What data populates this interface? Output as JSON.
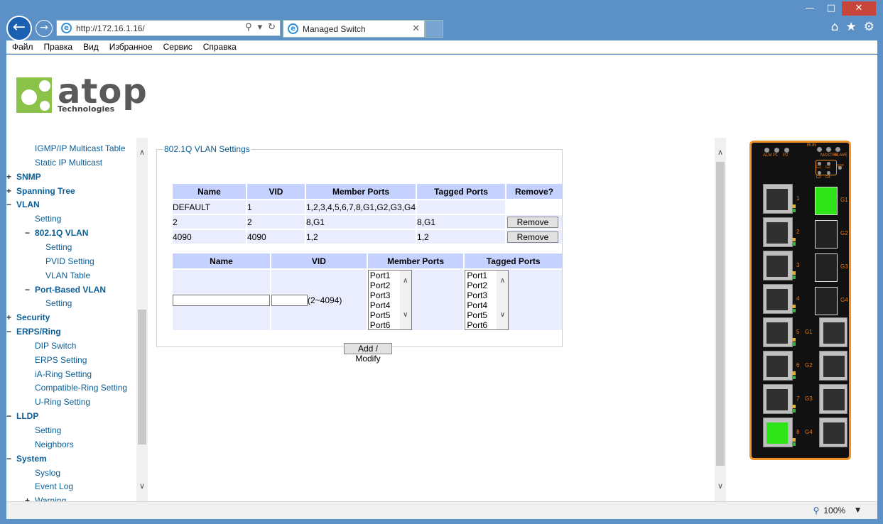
{
  "browser": {
    "url": "http://172.16.1.16/",
    "tab_title": "Managed Switch",
    "menu": [
      "Файл",
      "Правка",
      "Вид",
      "Избранное",
      "Сервис",
      "Справка"
    ],
    "zoom": "100%"
  },
  "logo": {
    "brand": "atop",
    "sub": "Technologies"
  },
  "sidebar": {
    "items": [
      {
        "label": "IGMP/IP Multicast Table",
        "toggle": "",
        "level": 1
      },
      {
        "label": "Static IP Multicast",
        "toggle": "",
        "level": 1
      },
      {
        "label": "SNMP",
        "toggle": "+",
        "level": 0
      },
      {
        "label": "Spanning Tree",
        "toggle": "+",
        "level": 0
      },
      {
        "label": "VLAN",
        "toggle": "−",
        "level": 0
      },
      {
        "label": "Setting",
        "toggle": "",
        "level": 1
      },
      {
        "label": "802.1Q VLAN",
        "toggle": "−",
        "level": 1,
        "bold": true
      },
      {
        "label": "Setting",
        "toggle": "",
        "level": 2
      },
      {
        "label": "PVID Setting",
        "toggle": "",
        "level": 2
      },
      {
        "label": "VLAN Table",
        "toggle": "",
        "level": 2
      },
      {
        "label": "Port-Based VLAN",
        "toggle": "−",
        "level": 1,
        "bold": true
      },
      {
        "label": "Setting",
        "toggle": "",
        "level": 2
      },
      {
        "label": "Security",
        "toggle": "+",
        "level": 0
      },
      {
        "label": "ERPS/Ring",
        "toggle": "−",
        "level": 0
      },
      {
        "label": "DIP Switch",
        "toggle": "",
        "level": 1
      },
      {
        "label": "ERPS Setting",
        "toggle": "",
        "level": 1
      },
      {
        "label": "iA-Ring Setting",
        "toggle": "",
        "level": 1
      },
      {
        "label": "Compatible-Ring Setting",
        "toggle": "",
        "level": 1
      },
      {
        "label": "U-Ring Setting",
        "toggle": "",
        "level": 1
      },
      {
        "label": "LLDP",
        "toggle": "−",
        "level": 0
      },
      {
        "label": "Setting",
        "toggle": "",
        "level": 1
      },
      {
        "label": "Neighbors",
        "toggle": "",
        "level": 1
      },
      {
        "label": "System",
        "toggle": "−",
        "level": 0
      },
      {
        "label": "Syslog",
        "toggle": "",
        "level": 1
      },
      {
        "label": "Event Log",
        "toggle": "",
        "level": 1
      },
      {
        "label": "Warning",
        "toggle": "+",
        "level": 1
      }
    ]
  },
  "vlan_settings": {
    "legend": "802.1Q VLAN Settings",
    "list_headers": [
      "Name",
      "VID",
      "Member Ports",
      "Tagged Ports",
      "Remove?"
    ],
    "rows": [
      {
        "name": "DEFAULT",
        "vid": "1",
        "members": "1,2,3,4,5,6,7,8,G1,G2,G3,G4",
        "tagged": "",
        "remove": ""
      },
      {
        "name": "2",
        "vid": "2",
        "members": "8,G1",
        "tagged": "8,G1",
        "remove": "Remove"
      },
      {
        "name": "4090",
        "vid": "4090",
        "members": "1,2",
        "tagged": "1,2",
        "remove": "Remove"
      }
    ],
    "form_headers": [
      "Name",
      "VID",
      "Member Ports",
      "Tagged Ports"
    ],
    "name_value": "",
    "vid_value": "",
    "vid_hint": "(2~4094)",
    "member_ports": [
      "Port1",
      "Port2",
      "Port3",
      "Port4",
      "Port5",
      "Port6"
    ],
    "tagged_ports": [
      "Port1",
      "Port2",
      "Port3",
      "Port4",
      "Port5",
      "Port6"
    ],
    "add_button": "Add / Modify"
  },
  "device_panel": {
    "top_leds": [
      "ALM",
      "P1",
      "P2"
    ],
    "right_leds": [
      "RUN",
      "MASTER",
      "SLAVE"
    ],
    "sfp_leds": [
      "G1",
      "G2",
      "G3",
      "G4",
      "SFP"
    ],
    "port_numbers": [
      "1",
      "2",
      "3",
      "4",
      "5",
      "6",
      "7",
      "8"
    ],
    "sfp_labels": [
      "G1",
      "G2",
      "G3",
      "G4"
    ],
    "gport_labels": [
      "G1",
      "G2",
      "G3",
      "G4"
    ],
    "active_color": "#2fe51a",
    "frame_color": "#f09128"
  }
}
